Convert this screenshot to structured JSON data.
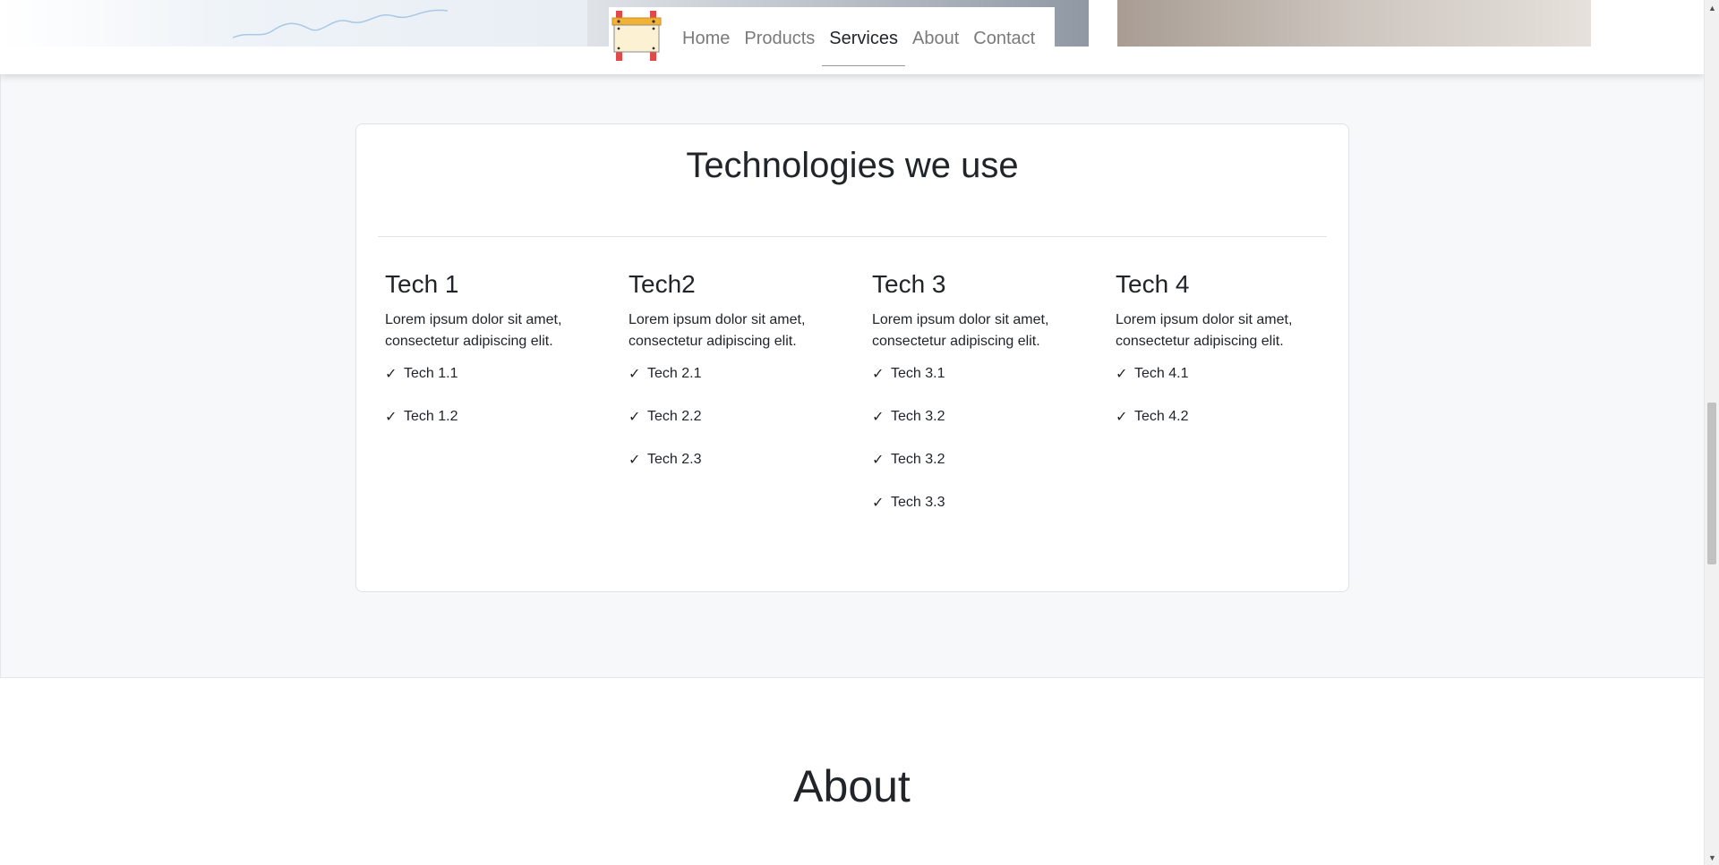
{
  "nav": {
    "items": [
      {
        "label": "Home"
      },
      {
        "label": "Products"
      },
      {
        "label": "Services"
      },
      {
        "label": "About"
      },
      {
        "label": "Contact"
      }
    ],
    "active": "Services"
  },
  "services": {
    "title": "Technologies we use",
    "columns": [
      {
        "title": "Tech 1",
        "description": "Lorem ipsum dolor sit amet, consectetur adipiscing elit.",
        "items": [
          "Tech 1.1",
          "Tech 1.2"
        ]
      },
      {
        "title": "Tech2",
        "description": "Lorem ipsum dolor sit amet, consectetur adipiscing elit.",
        "items": [
          "Tech 2.1",
          "Tech 2.2",
          "Tech 2.3"
        ]
      },
      {
        "title": "Tech 3",
        "description": "Lorem ipsum dolor sit amet, consectetur adipiscing elit.",
        "items": [
          "Tech 3.1",
          "Tech 3.2",
          "Tech 3.2",
          "Tech 3.3"
        ]
      },
      {
        "title": "Tech 4",
        "description": "Lorem ipsum dolor sit amet, consectetur adipiscing elit.",
        "items": [
          "Tech 4.1",
          "Tech 4.2"
        ]
      }
    ],
    "check_glyph": "✓"
  },
  "about": {
    "title": "About"
  },
  "colors": {
    "section_bg": "#f7f8fa",
    "text": "#212529",
    "nav_inactive": "#7a7a7a",
    "logo_post": "#e04a4a",
    "logo_beam": "#f2b233",
    "logo_board": "#fdf1d3"
  },
  "icons": {
    "logo": "construction-sign-icon",
    "check": "check-icon"
  }
}
